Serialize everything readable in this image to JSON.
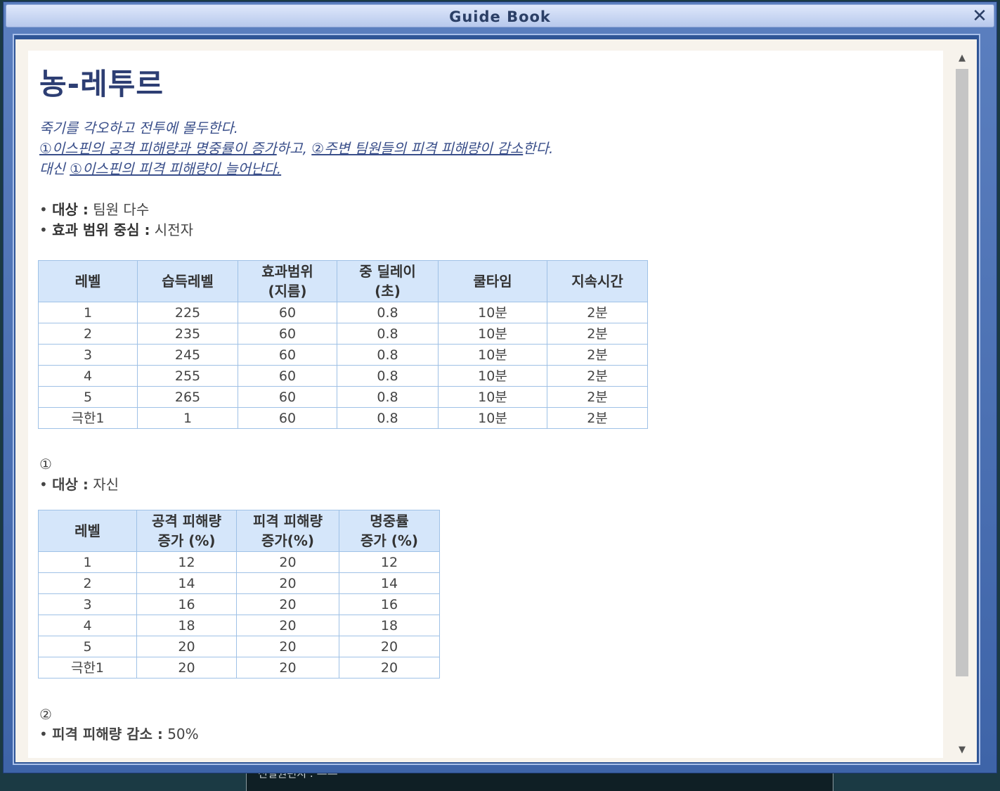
{
  "window": {
    "title": "Guide Book",
    "close_glyph": "✕"
  },
  "skill": {
    "name": "농-레투르",
    "description": {
      "line1": "죽기를 각오하고 전투에 몰두한다.",
      "line2_a": "①이스핀의 공격 피해량과 명중률이 증가",
      "line2_b": "하고, ",
      "line2_c": "②주변 팀원들의 피격 피해량이 감소",
      "line2_d": "한다.",
      "line3_a": "대신 ",
      "line3_b": "①이스핀의 피격 피해량이 늘어난다."
    },
    "bullets": [
      {
        "label": "대상 :",
        "value": " 팀원 다수"
      },
      {
        "label": "효과 범위 중심 :",
        "value": " 시전자"
      }
    ]
  },
  "table1": {
    "headers": [
      "레벨",
      "습득레벨",
      "효과범위\n(지름)",
      "중 딜레이\n(초)",
      "쿨타임",
      "지속시간"
    ],
    "rows": [
      [
        "1",
        "225",
        "60",
        "0.8",
        "10분",
        "2분"
      ],
      [
        "2",
        "235",
        "60",
        "0.8",
        "10분",
        "2분"
      ],
      [
        "3",
        "245",
        "60",
        "0.8",
        "10분",
        "2분"
      ],
      [
        "4",
        "255",
        "60",
        "0.8",
        "10분",
        "2분"
      ],
      [
        "5",
        "265",
        "60",
        "0.8",
        "10분",
        "2분"
      ],
      [
        "극한1",
        "1",
        "60",
        "0.8",
        "10분",
        "2분"
      ]
    ]
  },
  "section1": {
    "mark": "①",
    "bullet_label": "대상 :",
    "bullet_value": " 자신"
  },
  "table2": {
    "headers": [
      "레벨",
      "공격 피해량\n증가 (%)",
      "피격 피해량\n증가(%)",
      "명중률\n증가 (%)"
    ],
    "rows": [
      [
        "1",
        "12",
        "20",
        "12"
      ],
      [
        "2",
        "14",
        "20",
        "14"
      ],
      [
        "3",
        "16",
        "20",
        "16"
      ],
      [
        "4",
        "18",
        "20",
        "18"
      ],
      [
        "5",
        "20",
        "20",
        "20"
      ],
      [
        "극한1",
        "20",
        "20",
        "20"
      ]
    ]
  },
  "section2": {
    "mark": "②",
    "bullet_label": "피격 피해량 감소 :",
    "bullet_value": " 50%"
  },
  "scrollbar": {
    "up_glyph": "▲",
    "down_glyph": "▼"
  },
  "background_text": "신절원편지   :   ——"
}
